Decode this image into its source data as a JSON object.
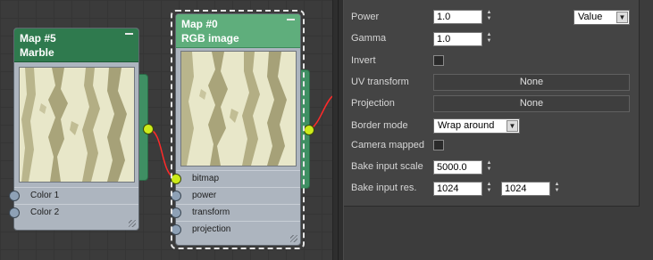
{
  "nodes": [
    {
      "title": "Map #5",
      "subtitle": "Marble",
      "header_color": "#2f7a4e",
      "inputs": [
        {
          "label": "Color 1"
        },
        {
          "label": "Color 2"
        }
      ]
    },
    {
      "title": "Map #0",
      "subtitle": "RGB image",
      "header_color": "#5fae7c",
      "inputs": [
        {
          "label": "bitmap"
        },
        {
          "label": "power"
        },
        {
          "label": "transform"
        },
        {
          "label": "projection"
        }
      ]
    }
  ],
  "colors": {
    "connection_wire": "#ff2a2a",
    "socket_connected": "#cdeb1a",
    "socket_default": "#8ea1b6"
  },
  "params": {
    "power": {
      "label": "Power",
      "value": "1.0"
    },
    "power_mode": {
      "value": "Value"
    },
    "gamma": {
      "label": "Gamma",
      "value": "1.0"
    },
    "invert": {
      "label": "Invert",
      "checked": false
    },
    "uv_transform": {
      "label": "UV transform",
      "button": "None"
    },
    "projection": {
      "label": "Projection",
      "button": "None"
    },
    "border_mode": {
      "label": "Border mode",
      "value": "Wrap around"
    },
    "camera_mapped": {
      "label": "Camera mapped",
      "checked": false
    },
    "bake_input_scale": {
      "label": "Bake input scale",
      "value": "5000.0"
    },
    "bake_input_res": {
      "label": "Bake input res.",
      "value_x": "1024",
      "value_y": "1024"
    }
  },
  "icons": {
    "spinner": "up-down-arrows-icon",
    "dropdown": "chevron-down-icon",
    "collapse": "minus-icon"
  }
}
